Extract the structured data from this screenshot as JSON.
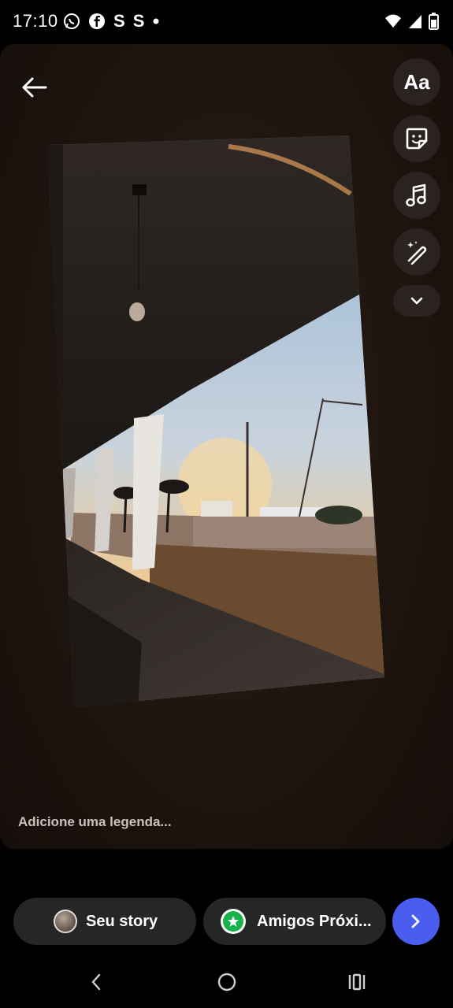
{
  "status_bar": {
    "time": "17:10",
    "notification_icons": [
      "whatsapp-icon",
      "facebook-icon",
      "s-app-icon",
      "s-app-icon",
      "dot-icon"
    ],
    "letters": [
      "S",
      "S"
    ],
    "right_icons": [
      "wifi-icon",
      "signal-icon",
      "battery-icon"
    ]
  },
  "editor": {
    "tools": [
      {
        "name": "text-tool",
        "label": "Aa"
      },
      {
        "name": "sticker-tool",
        "icon": "sticker-icon"
      },
      {
        "name": "music-tool",
        "icon": "music-note-icon"
      },
      {
        "name": "effects-tool",
        "icon": "magic-wand-icon"
      },
      {
        "name": "more-tools",
        "icon": "chevron-down-icon"
      }
    ],
    "caption_placeholder": "Adicione uma legenda..."
  },
  "share": {
    "your_story_label": "Seu story",
    "close_friends_label": "Amigos Próxi...",
    "next_icon": "chevron-right-icon",
    "accent_color": "#4b5cf0",
    "close_friends_color": "#19b34b"
  },
  "nav": {
    "buttons": [
      "back-nav-icon",
      "home-nav-icon",
      "recents-nav-icon"
    ]
  }
}
